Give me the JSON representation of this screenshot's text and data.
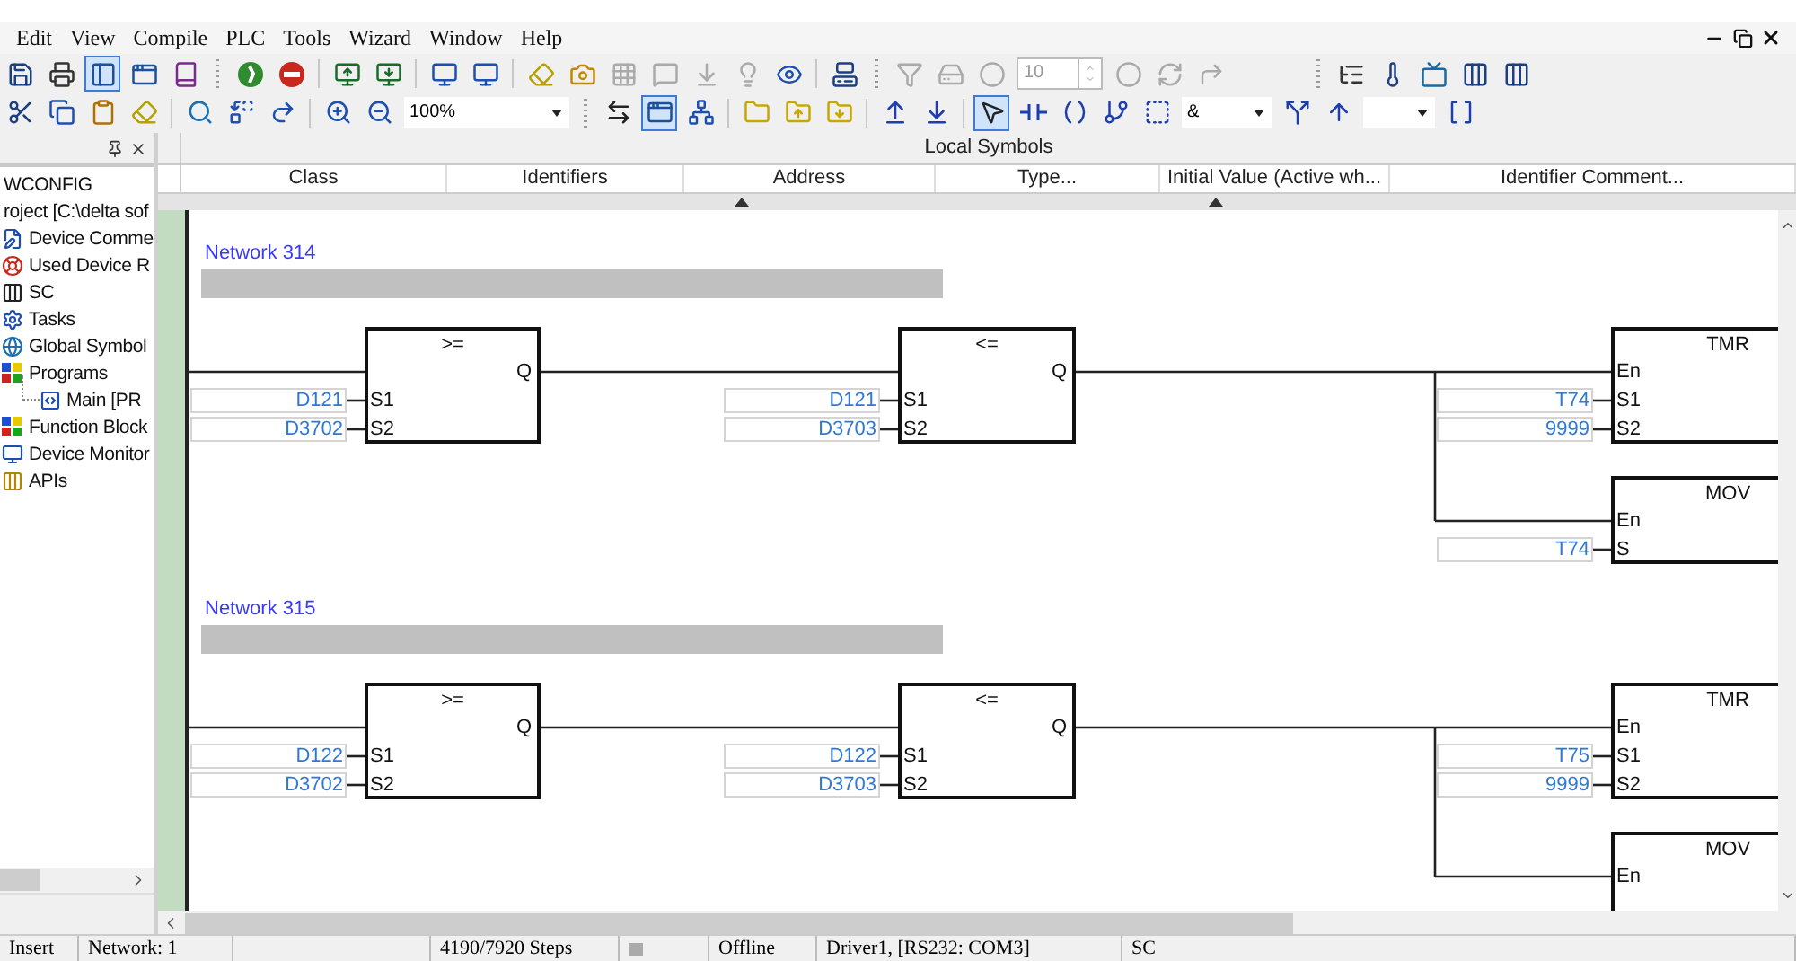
{
  "menu": [
    "Edit",
    "View",
    "Compile",
    "PLC",
    "Tools",
    "Wizard",
    "Window",
    "Help"
  ],
  "toolbars": [
    {
      "left": [
        {
          "kind": "save",
          "selected": false,
          "disabled": false
        },
        {
          "kind": "print",
          "selected": false,
          "disabled": false
        },
        {
          "kind": "layout",
          "selected": true,
          "disabled": false
        },
        {
          "kind": "window",
          "selected": false,
          "disabled": false
        },
        {
          "kind": "book",
          "selected": false,
          "disabled": false
        },
        {
          "kind": "grip"
        },
        {
          "kind": "run",
          "selected": false,
          "disabled": false
        },
        {
          "kind": "stop",
          "selected": false,
          "disabled": false
        },
        {
          "kind": "separator"
        },
        {
          "kind": "upload",
          "selected": false,
          "disabled": false
        },
        {
          "kind": "download",
          "selected": false,
          "disabled": false
        },
        {
          "kind": "separator"
        },
        {
          "kind": "monitor",
          "selected": false,
          "disabled": false
        },
        {
          "kind": "monitor",
          "selected": false,
          "disabled": false
        },
        {
          "kind": "separator"
        },
        {
          "kind": "eraser",
          "selected": false,
          "disabled": false
        },
        {
          "kind": "camera",
          "selected": false,
          "disabled": false
        },
        {
          "kind": "grid",
          "selected": false,
          "disabled": true
        },
        {
          "kind": "comment",
          "selected": false,
          "disabled": true
        },
        {
          "kind": "arrow-box",
          "selected": false,
          "disabled": true
        },
        {
          "kind": "bulb",
          "selected": false,
          "disabled": true
        },
        {
          "kind": "eye",
          "selected": false,
          "disabled": false
        },
        {
          "kind": "separator"
        },
        {
          "kind": "computer",
          "selected": false,
          "disabled": false
        },
        {
          "kind": "grip"
        },
        {
          "kind": "funnel",
          "selected": false,
          "disabled": true
        },
        {
          "kind": "drive",
          "selected": false,
          "disabled": true
        },
        {
          "kind": "circle",
          "selected": false,
          "disabled": true
        },
        {
          "kind": "spin",
          "value": "10",
          "disabled": true
        },
        {
          "kind": "circle",
          "selected": false,
          "disabled": true
        },
        {
          "kind": "refresh",
          "selected": false,
          "disabled": true
        },
        {
          "kind": "redo",
          "selected": false,
          "disabled": true
        }
      ],
      "right": [
        {
          "kind": "grip"
        },
        {
          "kind": "list-tree",
          "selected": false,
          "disabled": false
        },
        {
          "kind": "thermometer",
          "selected": false,
          "disabled": false
        },
        {
          "kind": "screen",
          "selected": false,
          "disabled": false
        },
        {
          "kind": "columns",
          "selected": false,
          "disabled": false
        },
        {
          "kind": "columns",
          "selected": false,
          "disabled": false
        }
      ]
    },
    {
      "left": [
        {
          "kind": "cut",
          "selected": false,
          "disabled": false
        },
        {
          "kind": "copy",
          "selected": false,
          "disabled": false
        },
        {
          "kind": "paste",
          "selected": false,
          "disabled": false
        },
        {
          "kind": "eraser",
          "selected": false,
          "disabled": false
        },
        {
          "kind": "separator"
        },
        {
          "kind": "search",
          "selected": false,
          "disabled": false
        },
        {
          "kind": "replace",
          "selected": false,
          "disabled": false
        },
        {
          "kind": "goto",
          "selected": false,
          "disabled": false
        },
        {
          "kind": "separator"
        },
        {
          "kind": "zoom-in",
          "selected": false,
          "disabled": false
        },
        {
          "kind": "zoom-out",
          "selected": false,
          "disabled": false
        },
        {
          "kind": "combo",
          "value": "100%"
        },
        {
          "kind": "grip"
        },
        {
          "kind": "address",
          "selected": false,
          "disabled": false
        },
        {
          "kind": "window",
          "selected": true,
          "disabled": false
        },
        {
          "kind": "network",
          "selected": false,
          "disabled": false
        },
        {
          "kind": "separator"
        },
        {
          "kind": "folder",
          "selected": false,
          "disabled": false
        },
        {
          "kind": "folder-up",
          "selected": false,
          "disabled": false
        },
        {
          "kind": "folder-down",
          "selected": false,
          "disabled": false
        },
        {
          "kind": "separator"
        },
        {
          "kind": "bars-up",
          "selected": false,
          "disabled": false
        },
        {
          "kind": "bars-down",
          "selected": false,
          "disabled": false
        },
        {
          "kind": "separator"
        },
        {
          "kind": "pointer",
          "selected": true,
          "disabled": false
        },
        {
          "kind": "contact",
          "selected": false,
          "disabled": false
        },
        {
          "kind": "coil",
          "selected": false,
          "disabled": false
        },
        {
          "kind": "branch",
          "selected": false,
          "disabled": false
        },
        {
          "kind": "block",
          "selected": false,
          "disabled": false
        },
        {
          "kind": "combo",
          "value": "&"
        },
        {
          "kind": "split",
          "selected": false,
          "disabled": false
        },
        {
          "kind": "arrow-up",
          "selected": false,
          "disabled": false
        },
        {
          "kind": "combo"
        },
        {
          "kind": "bracket",
          "selected": false,
          "disabled": false
        }
      ]
    }
  ],
  "tree": [
    {
      "label": "WCONFIG"
    },
    {
      "label": "roject [C:\\delta sof",
      "children": [
        {
          "label": "Device Comme"
        },
        {
          "label": "Used Device R"
        },
        {
          "label": "SC"
        },
        {
          "label": "Tasks"
        },
        {
          "label": "Global Symbol"
        },
        {
          "label": "Programs",
          "children": [
            {
              "label": "Main [PR"
            }
          ]
        },
        {
          "label": "Function Block"
        },
        {
          "label": "Device Monitor"
        },
        {
          "label": "APIs"
        }
      ]
    }
  ],
  "symbols": {
    "title": "Local Symbols",
    "columns": [
      "Class",
      "Identifiers",
      "Address",
      "Type...",
      "Initial Value (Active wh...",
      "Identifier Comment..."
    ]
  },
  "networks": [
    {
      "title": "Network 314",
      "blocks": [
        {
          "name": ">=",
          "output": "Q",
          "pins": [
            {
              "label": "S1",
              "operand": "D121"
            },
            {
              "label": "S2",
              "operand": "D3702"
            }
          ]
        },
        {
          "name": "<=",
          "output": "Q",
          "pins": [
            {
              "label": "S1",
              "operand": "D121"
            },
            {
              "label": "S2",
              "operand": "D3703"
            }
          ]
        },
        {
          "name": "TMR",
          "pins": [
            {
              "label": "En"
            },
            {
              "label": "S1",
              "operand": "T74"
            },
            {
              "label": "S2",
              "operand": "9999"
            }
          ]
        },
        {
          "name": "MOV",
          "pins": [
            {
              "label": "En"
            },
            {
              "label": "S",
              "operand": "T74"
            }
          ]
        }
      ]
    },
    {
      "title": "Network 315",
      "blocks": [
        {
          "name": ">=",
          "output": "Q",
          "pins": [
            {
              "label": "S1",
              "operand": "D122"
            },
            {
              "label": "S2",
              "operand": "D3702"
            }
          ]
        },
        {
          "name": "<=",
          "output": "Q",
          "pins": [
            {
              "label": "S1",
              "operand": "D122"
            },
            {
              "label": "S2",
              "operand": "D3703"
            }
          ]
        },
        {
          "name": "TMR",
          "pins": [
            {
              "label": "En"
            },
            {
              "label": "S1",
              "operand": "T75"
            },
            {
              "label": "S2",
              "operand": "9999"
            }
          ]
        },
        {
          "name": "MOV",
          "pins": [
            {
              "label": "En"
            }
          ]
        }
      ]
    }
  ],
  "status_bar": {
    "mode": "Insert",
    "network": "Network: 1",
    "steps": "4190/7920 Steps",
    "connection": "Offline",
    "driver": "Driver1, [RS232: COM3]",
    "model": "SC"
  }
}
